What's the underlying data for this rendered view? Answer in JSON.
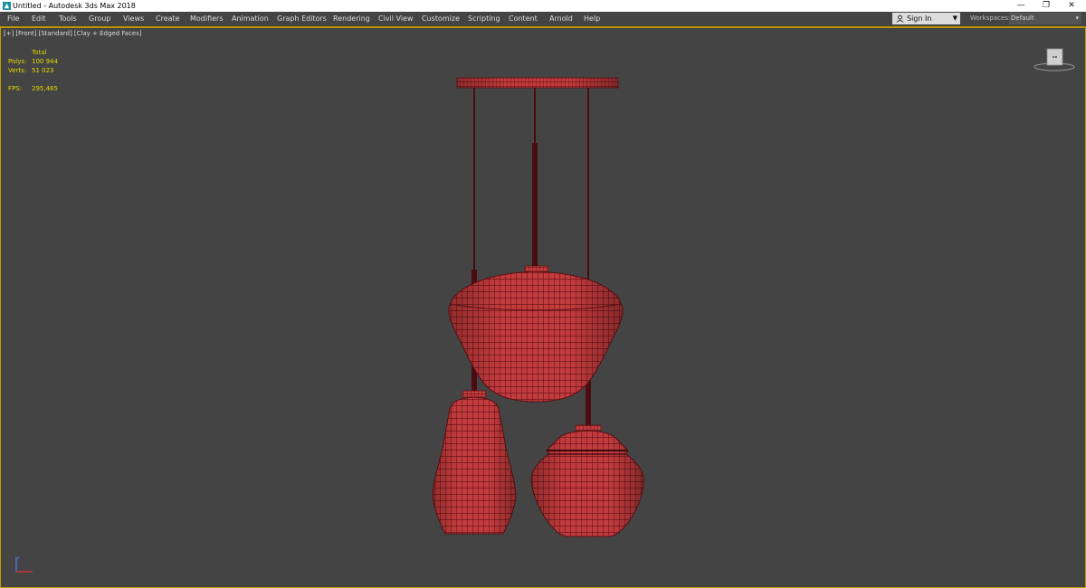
{
  "window": {
    "title": "Untitled - Autodesk 3ds Max 2018",
    "minimize": "—",
    "restore": "❐",
    "close": "✕"
  },
  "menu": [
    "File",
    "Edit",
    "Tools",
    "Group",
    "Views",
    "Create",
    "Modifiers",
    "Animation",
    "Graph Editors",
    "Rendering",
    "Civil View",
    "Customize",
    "Scripting",
    "Content",
    "Arnold",
    "Help"
  ],
  "account": {
    "sign_in": "Sign In"
  },
  "workspaces": {
    "label": "Workspaces:",
    "value": "Default"
  },
  "viewport": {
    "label_plus": "[+]",
    "label_view": "[Front]",
    "label_shading_mode": "[Standard]",
    "label_display": "[Clay + Edged Faces]"
  },
  "stats": {
    "total_label": "Total",
    "polys_label": "Polys:",
    "polys_value": "100 944",
    "verts_label": "Verts:",
    "verts_value": "51 023",
    "fps_label": "FPS:",
    "fps_value": "295,465"
  },
  "colors": {
    "viewport_bg": "#444444",
    "stats_text": "#e6d800",
    "model_fill": "#c0393b",
    "model_wire": "#5a0f12",
    "border_active": "#b8a000"
  },
  "icons": {
    "app": "3dsmax-logo-icon",
    "user": "user-icon",
    "viewcube": "viewcube-icon",
    "axis": "axis-tripod-icon"
  }
}
